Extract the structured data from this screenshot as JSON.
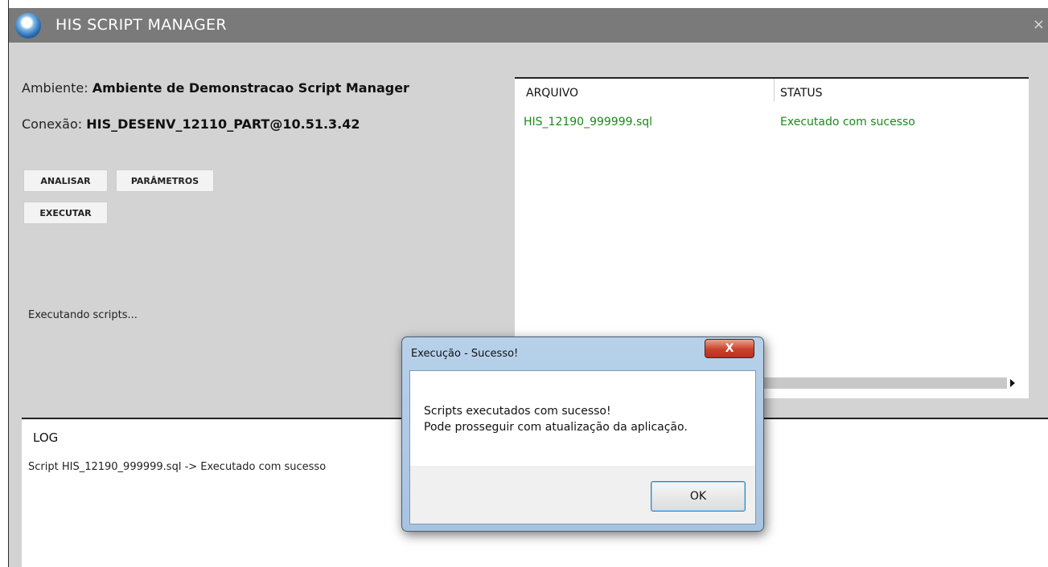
{
  "window": {
    "title": "HIS SCRIPT MANAGER",
    "close_glyph": "×"
  },
  "info": {
    "ambiente_label": "Ambiente:",
    "ambiente_value": "Ambiente de Demonstracao Script Manager",
    "conexao_label": "Conexão:",
    "conexao_value": "HIS_DESENV_12110_PART@10.51.3.42"
  },
  "buttons": {
    "analisar": "ANALISAR",
    "parametros": "PARÂMETROS",
    "executar": "EXECUTAR"
  },
  "status_text": "Executando scripts...",
  "file_table": {
    "headers": [
      "ARQUIVO",
      "STATUS"
    ],
    "rows": [
      {
        "arquivo": "HIS_12190_999999.sql",
        "status": "Executado com sucesso"
      }
    ],
    "row_color": "#1a8a1a"
  },
  "log": {
    "title": "LOG",
    "entries": [
      "Script HIS_12190_999999.sql -> Executado com sucesso"
    ]
  },
  "dialog": {
    "title": "Execução - Sucesso!",
    "close_glyph": "X",
    "message_line1": "Scripts executados com sucesso!",
    "message_line2": " Pode prosseguir com atualização da aplicação.",
    "ok_label": "OK"
  },
  "icons": {
    "app_logo": "app-logo-icon",
    "close": "close-icon",
    "scroll_right": "scroll-right-arrow-icon"
  }
}
